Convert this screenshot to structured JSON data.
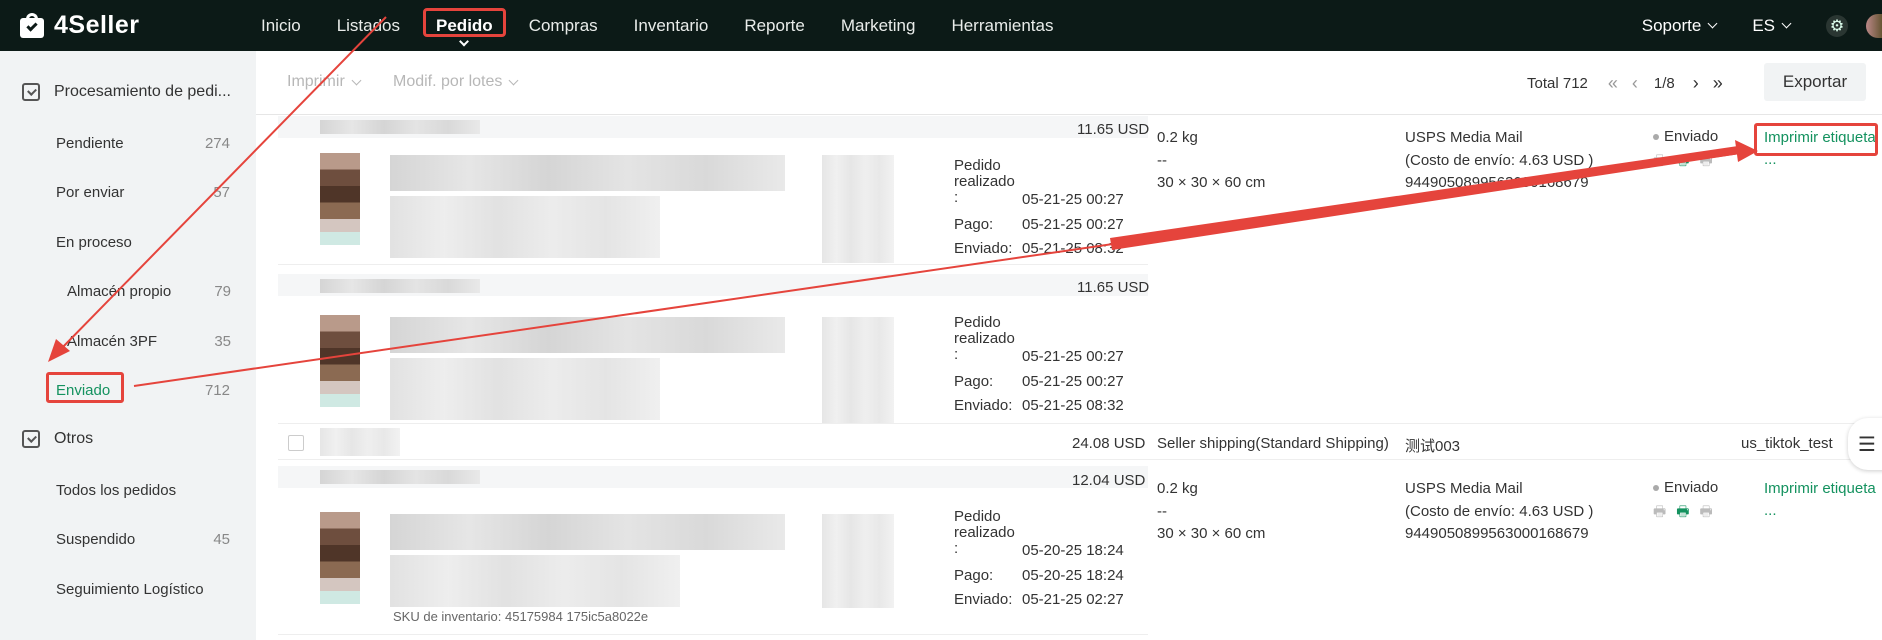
{
  "app": {
    "name": "4Seller"
  },
  "nav": {
    "items": [
      "Inicio",
      "Listados",
      "Pedido",
      "Compras",
      "Inventario",
      "Reporte",
      "Marketing",
      "Herramientas"
    ],
    "active": "Pedido"
  },
  "topright": {
    "support": "Soporte",
    "lang": "ES"
  },
  "sidebar": {
    "group1": "Procesamiento de pedi...",
    "pendiente": {
      "label": "Pendiente",
      "count": "274"
    },
    "porenviar": {
      "label": "Por enviar",
      "count": "57"
    },
    "enproceso": {
      "label": "En proceso"
    },
    "almacenpropio": {
      "label": "Almacén propio",
      "count": "79"
    },
    "almacen3pf": {
      "label": "Almacén 3PF",
      "count": "35"
    },
    "enviado": {
      "label": "Enviado",
      "count": "712"
    },
    "group2": "Otros",
    "todos": {
      "label": "Todos los pedidos"
    },
    "suspendido": {
      "label": "Suspendido",
      "count": "45"
    },
    "seguimiento": {
      "label": "Seguimiento Logístico"
    }
  },
  "toolbar": {
    "imprimir": "Imprimir",
    "modif": "Modif. por lotes",
    "total": "Total 712",
    "page": "1/8",
    "export": "Exportar"
  },
  "orders": {
    "o1": {
      "price": "11.65 USD",
      "weight": "0.2 kg",
      "dash": "--",
      "dims": "30 × 30 × 60 cm",
      "carrier": "USPS Media Mail",
      "cost": "(Costo de envío:  4.63 USD )",
      "tracking": "9449050899563000168679",
      "status": "Enviado",
      "action": "Imprimir etiqueta",
      "more": "...",
      "pedido_l1": "Pedido",
      "pedido_l2": "realizado",
      "pedido_l3": ":",
      "pedido_val": "05-21-25 00:27",
      "pago_label": "Pago:",
      "pago_val": "05-21-25 00:27",
      "enviado_label": "Enviado:",
      "enviado_val": "05-21-25 08:32"
    },
    "o2": {
      "price": "11.65 USD",
      "pedido_val": "05-21-25 00:27",
      "pago_val": "05-21-25 00:27",
      "enviado_val": "05-21-25 08:32"
    },
    "o3": {
      "price_total": "24.08 USD",
      "shipping_method": "Seller shipping(Standard Shipping)",
      "warehouse": "测试003",
      "store": "us_tiktok_test",
      "price": "12.04 USD",
      "weight": "0.2 kg",
      "dash": "--",
      "dims": "30 × 30 × 60 cm",
      "carrier": "USPS Media Mail",
      "cost": "(Costo de envío:  4.63 USD )",
      "tracking": "9449050899563000168679",
      "status": "Enviado",
      "action": "Imprimir etiqueta",
      "more": "...",
      "pedido_val": "05-20-25 18:24",
      "pago_val": "05-20-25 18:24",
      "enviado_val": "05-21-25 02:27",
      "sku": "SKU de inventario: 45175984 175ic5a8022e"
    }
  },
  "colors": {
    "accent": "#14925f",
    "nav_bg": "#0c1a17",
    "highlight": "#e5443c"
  }
}
